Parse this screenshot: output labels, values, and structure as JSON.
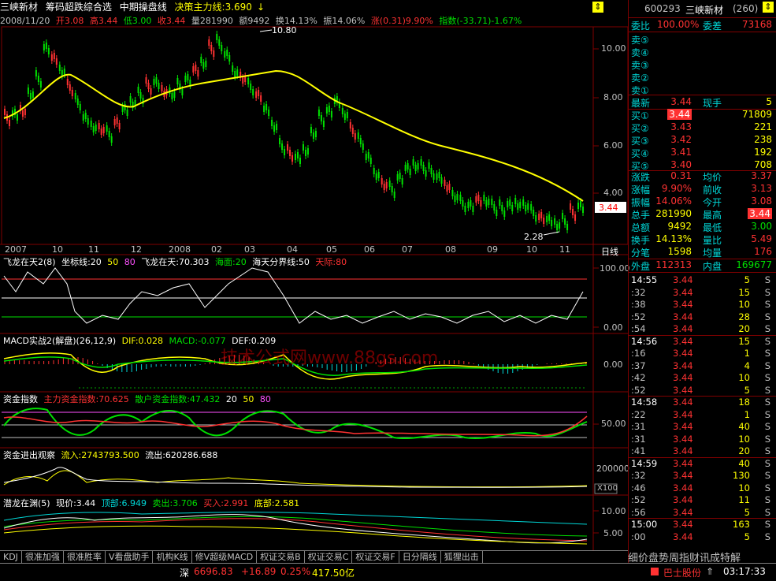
{
  "title": {
    "stock_name": "三峡新材",
    "indicator": "筹码超跌综合选",
    "period": "中期操盘线",
    "decision_label": "决策主力线:3.690",
    "arrow_icon": "down-arrow"
  },
  "info_bar": {
    "date": "2008/11/20",
    "open": "开3.08",
    "high": "高3.44",
    "low": "低3.00",
    "close": "收3.44",
    "volume": "量281990",
    "amount": "额9492",
    "turnover": "换14.13%",
    "amplitude": "振14.06%",
    "change": "涨(0.31)9.90%",
    "index": "指数(-33.71)-1.67%"
  },
  "main_chart": {
    "y_labels": [
      "10.00",
      "8.00",
      "6.00",
      "4.00"
    ],
    "price_tag": "3.44",
    "high_mark": "10.80",
    "low_mark": "2.28",
    "x_labels": [
      "2007",
      "10",
      "11",
      "12",
      "2008",
      "02",
      "03",
      "04",
      "05",
      "06",
      "07",
      "08",
      "09",
      "10",
      "11"
    ],
    "period_label": "日线"
  },
  "panels": {
    "p1": {
      "name": "飞龙在天2(8)",
      "coord": "坐标线:20",
      "v50": "50",
      "v80": "80",
      "fly": "飞龙在天:70.303",
      "sea": "海面:20",
      "sky": "海天分界线:50",
      "top": "天际:80",
      "y_top": "100.00",
      "y_bottom": "0.00"
    },
    "p2": {
      "name": "MACD实战2(解盘)(26,12,9)",
      "dif": "DIF:0.028",
      "macd": "MACD:-0.077",
      "def": "DEF:0.209",
      "y_zero": "0.00"
    },
    "p3": {
      "name": "资金指数",
      "main": "主力资金指数:70.625",
      "retail": "散户资金指数:47.432",
      "v20": "20",
      "v50": "50",
      "v80": "80",
      "y_mid": "50.00"
    },
    "p4": {
      "name": "资金进出观察",
      "inflow": "流入:2743793.500",
      "outflow": "流出:620286.688",
      "y_top": "200000",
      "scale": "X100"
    },
    "p5": {
      "name": "潜龙在渊(5)",
      "now": "现价:3.44",
      "top": "顶部:6.949",
      "sell": "卖出:3.706",
      "buy": "买入:2.991",
      "bottom": "底部:2.581",
      "y_top": "10.00",
      "y_mid": "5.00"
    }
  },
  "watermark": "技术公式网www.88gs.com",
  "quote": {
    "code": "600293",
    "name": "三峡新材",
    "count": "(260)",
    "weibi_label": "委比",
    "weibi_value": "100.00%",
    "weicha_label": "委差",
    "weicha_value": "73168",
    "sells": [
      "卖⑤",
      "卖④",
      "卖③",
      "卖②",
      "卖①"
    ],
    "latest_label": "最新",
    "latest": "3.44",
    "now_hand_label": "现手",
    "now_hand": "5",
    "buys": [
      {
        "label": "买①",
        "price": "3.44",
        "vol": "71809"
      },
      {
        "label": "买②",
        "price": "3.43",
        "vol": "221"
      },
      {
        "label": "买③",
        "price": "3.42",
        "vol": "238"
      },
      {
        "label": "买④",
        "price": "3.41",
        "vol": "192"
      },
      {
        "label": "买⑤",
        "price": "3.40",
        "vol": "708"
      }
    ],
    "stats": [
      {
        "l1": "涨跌",
        "v1": "0.31",
        "l2": "均价",
        "v2": "3.37"
      },
      {
        "l1": "涨幅",
        "v1": "9.90%",
        "l2": "前收",
        "v2": "3.13"
      },
      {
        "l1": "振幅",
        "v1": "14.06%",
        "l2": "今开",
        "v2": "3.08"
      },
      {
        "l1": "总手",
        "v1": "281990",
        "l2": "最高",
        "v2": "3.44"
      },
      {
        "l1": "总额",
        "v1": "9492",
        "l2": "最低",
        "v2": "3.00"
      },
      {
        "l1": "换手",
        "v1": "14.13%",
        "l2": "量比",
        "v2": "5.49"
      },
      {
        "l1": "分笔",
        "v1": "1598",
        "l2": "均量",
        "v2": "176"
      }
    ],
    "outer_label": "外盘",
    "outer": "112313",
    "inner_label": "内盘",
    "inner": "169677"
  },
  "ticks": [
    {
      "t": "14:55",
      "p": "3.44",
      "v": "5",
      "s": "S"
    },
    {
      "t": ":32",
      "p": "3.44",
      "v": "15",
      "s": "S"
    },
    {
      "t": ":38",
      "p": "3.44",
      "v": "10",
      "s": "S"
    },
    {
      "t": ":52",
      "p": "3.44",
      "v": "28",
      "s": "S"
    },
    {
      "t": ":54",
      "p": "3.44",
      "v": "20",
      "s": "S"
    },
    {
      "t": "14:56",
      "p": "3.44",
      "v": "15",
      "s": "S"
    },
    {
      "t": ":16",
      "p": "3.44",
      "v": "1",
      "s": "S"
    },
    {
      "t": ":37",
      "p": "3.44",
      "v": "4",
      "s": "S"
    },
    {
      "t": ":42",
      "p": "3.44",
      "v": "10",
      "s": "S"
    },
    {
      "t": ":52",
      "p": "3.44",
      "v": "5",
      "s": "S"
    },
    {
      "t": "14:58",
      "p": "3.44",
      "v": "18",
      "s": "S"
    },
    {
      "t": ":22",
      "p": "3.44",
      "v": "1",
      "s": "S"
    },
    {
      "t": ":31",
      "p": "3.44",
      "v": "40",
      "s": "S"
    },
    {
      "t": ":31",
      "p": "3.44",
      "v": "10",
      "s": "S"
    },
    {
      "t": ":41",
      "p": "3.44",
      "v": "20",
      "s": "S"
    },
    {
      "t": "14:59",
      "p": "3.44",
      "v": "40",
      "s": "S"
    },
    {
      "t": ":32",
      "p": "3.44",
      "v": "130",
      "s": "S"
    },
    {
      "t": ":46",
      "p": "3.44",
      "v": "10",
      "s": "S"
    },
    {
      "t": ":52",
      "p": "3.44",
      "v": "11",
      "s": "S"
    },
    {
      "t": ":56",
      "p": "3.44",
      "v": "5",
      "s": "S"
    },
    {
      "t": "15:00",
      "p": "3.44",
      "v": "163",
      "s": "S"
    },
    {
      "t": ":00",
      "p": "3.44",
      "v": "5",
      "s": "S"
    }
  ],
  "tabs": [
    "KDJ",
    "很准加强",
    "很准胜率",
    "V看盘助手",
    "机构K线",
    "修V超级MACD",
    "权证交易B",
    "权证交易C",
    "权证交易F",
    "日分隔线",
    "狐狸出击"
  ],
  "marquee": "细价盘势周指财讯成特解",
  "status": {
    "market": "深",
    "index": "6696.83",
    "change": "+16.89",
    "pct": "0.25%",
    "amount": "417.50亿",
    "broker": "巴士股份",
    "time": "03:17:33"
  },
  "colors": {
    "up": "#ff3232",
    "down": "#00e000",
    "ma": "#ffff00",
    "frame": "#800000",
    "text": "#c0c0c0"
  }
}
